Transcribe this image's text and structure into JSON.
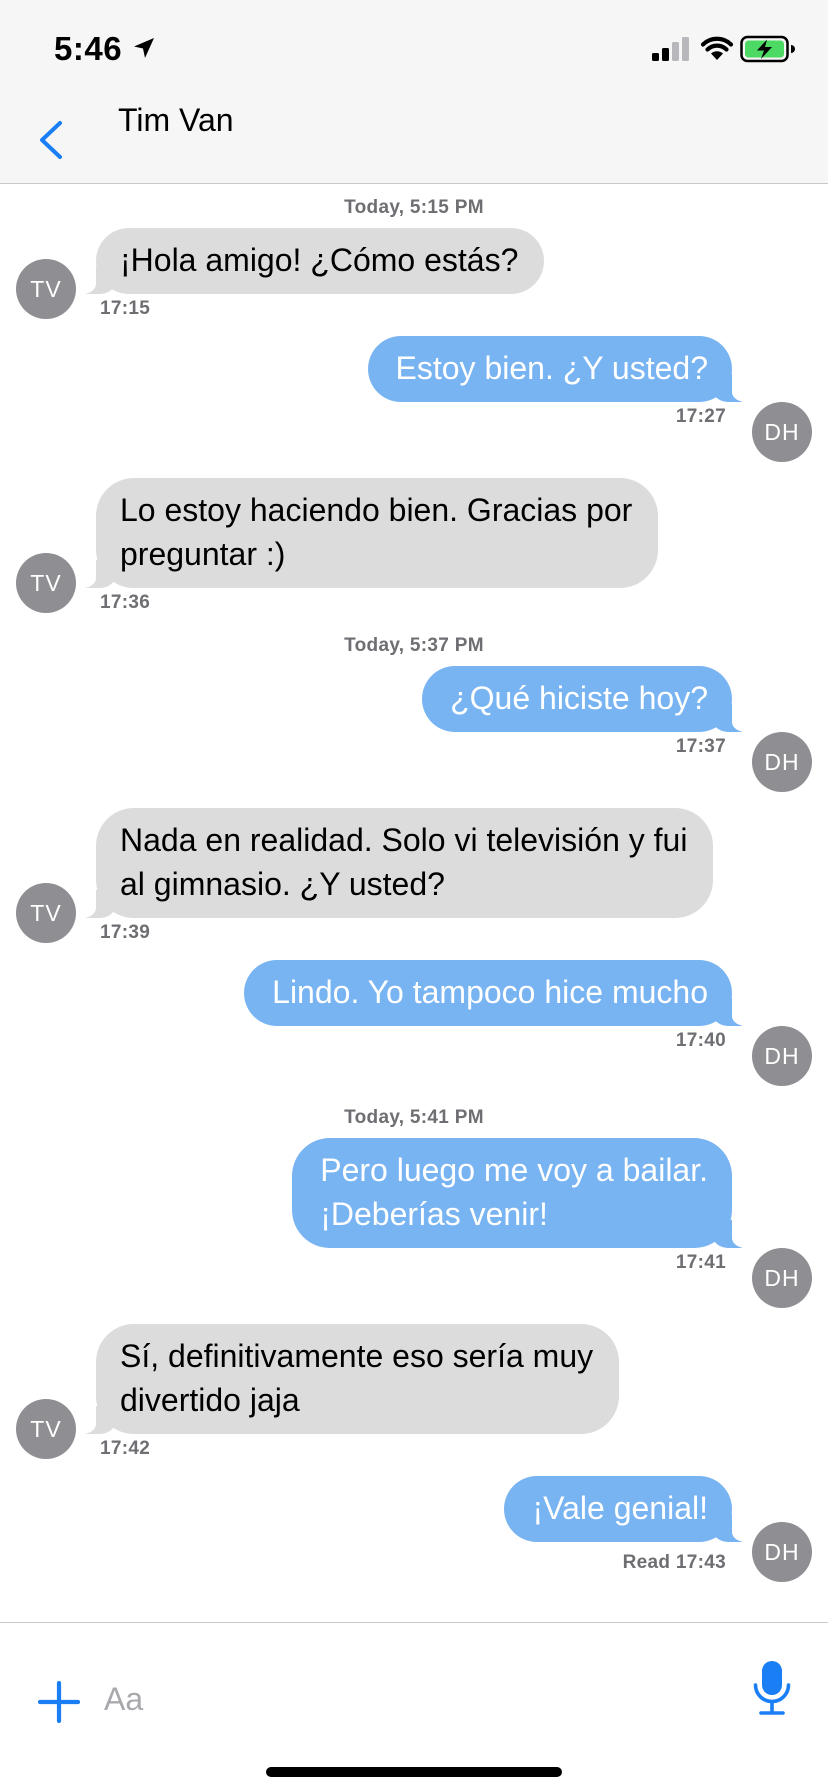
{
  "status_bar": {
    "time": "5:46",
    "location_icon": "location-arrow-icon",
    "signal_icon": "cellular-signal-icon",
    "wifi_icon": "wifi-icon",
    "battery_icon": "battery-charging-icon"
  },
  "nav": {
    "back_icon": "chevron-left-icon",
    "contact_name": "Tim Van"
  },
  "colors": {
    "incoming_bubble": "#dcdcdc",
    "outgoing_bubble": "#79b4f2",
    "accent": "#1a7ef5",
    "avatar": "#8e8e93"
  },
  "avatars": {
    "contact": "TV",
    "me": "DH"
  },
  "conversation": [
    {
      "type": "timestamp",
      "text": "Today, 5:15 PM"
    },
    {
      "type": "message",
      "direction": "in",
      "lines": [
        "¡Hola amigo! ¿Cómo estás?"
      ],
      "time": "17:15"
    },
    {
      "type": "message",
      "direction": "out",
      "lines": [
        "Estoy bien. ¿Y usted?"
      ],
      "time": "17:27"
    },
    {
      "type": "message",
      "direction": "in",
      "lines": [
        "Lo estoy haciendo bien. Gracias por",
        "preguntar :)"
      ],
      "time": "17:36"
    },
    {
      "type": "timestamp",
      "text": "Today, 5:37 PM"
    },
    {
      "type": "message",
      "direction": "out",
      "lines": [
        "¿Qué hiciste hoy?"
      ],
      "time": "17:37"
    },
    {
      "type": "message",
      "direction": "in",
      "lines": [
        "Nada en realidad. Solo vi televisión y fui",
        "al gimnasio. ¿Y usted?"
      ],
      "time": "17:39"
    },
    {
      "type": "message",
      "direction": "out",
      "lines": [
        "Lindo. Yo tampoco hice mucho"
      ],
      "time": "17:40"
    },
    {
      "type": "timestamp",
      "text": "Today, 5:41 PM"
    },
    {
      "type": "message",
      "direction": "out",
      "lines": [
        "Pero luego me voy a bailar.",
        "¡Deberías venir!"
      ],
      "time": "17:41"
    },
    {
      "type": "message",
      "direction": "in",
      "lines": [
        "Sí, definitivamente eso sería muy",
        "divertido jaja"
      ],
      "time": "17:42"
    },
    {
      "type": "message",
      "direction": "out",
      "lines": [
        "¡Vale genial!"
      ],
      "time": "Read 17:43"
    }
  ],
  "composer": {
    "plus_icon": "plus-icon",
    "placeholder": "Aa",
    "value": "",
    "mic_icon": "microphone-icon"
  }
}
